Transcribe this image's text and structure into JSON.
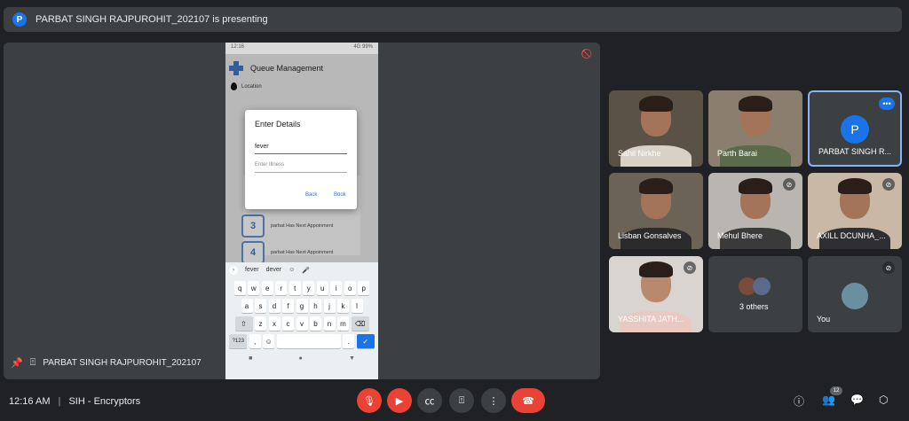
{
  "banner": {
    "avatar_letter": "P",
    "text": "PARBAT SINGH RAJPUROHIT_202107 is presenting"
  },
  "presentation": {
    "phone": {
      "status_time": "12:16",
      "status_right": "4G 99%",
      "app_title": "Queue Management",
      "location_label": "Location",
      "queue": [
        {
          "num": "3",
          "text": "parbat Has Next Appoinment"
        },
        {
          "num": "4",
          "text": "parbat Has Next Appoinment"
        }
      ],
      "dialog": {
        "title": "Enter Details",
        "field1_value": "fever",
        "field2_placeholder": "Enter Illness",
        "back": "Back",
        "book": "Book"
      },
      "keyboard": {
        "suggestions": [
          "fever",
          "dever"
        ],
        "row1": [
          "q",
          "w",
          "e",
          "r",
          "t",
          "y",
          "u",
          "i",
          "o",
          "p"
        ],
        "row2": [
          "a",
          "s",
          "d",
          "f",
          "g",
          "h",
          "j",
          "k",
          "l"
        ],
        "row3": [
          "z",
          "x",
          "c",
          "v",
          "b",
          "n",
          "m"
        ],
        "sym": "?123",
        "comma": ",",
        "period": "."
      }
    },
    "presenter_name": "PARBAT SINGH RAJPUROHIT_202107"
  },
  "participants": [
    {
      "name": "Sahil Nirkhe"
    },
    {
      "name": "Parth Barai"
    },
    {
      "name": "PARBAT SINGH R...",
      "avatar_letter": "P"
    },
    {
      "name": "Lisban Gonsalves"
    },
    {
      "name": "Mehul Bhere"
    },
    {
      "name": "AXILL DCUNHA_..."
    },
    {
      "name": "YASSHITA JATH..."
    },
    {
      "name": "3 others"
    },
    {
      "name": "You"
    }
  ],
  "controls": {
    "time": "12:16 AM",
    "separator": "|",
    "meeting_name": "SIH - Encryptors",
    "people_count": "12"
  },
  "colors": {
    "background": "#202124",
    "surface": "#3c4043",
    "accent": "#1a73e8",
    "danger": "#ea4335"
  }
}
